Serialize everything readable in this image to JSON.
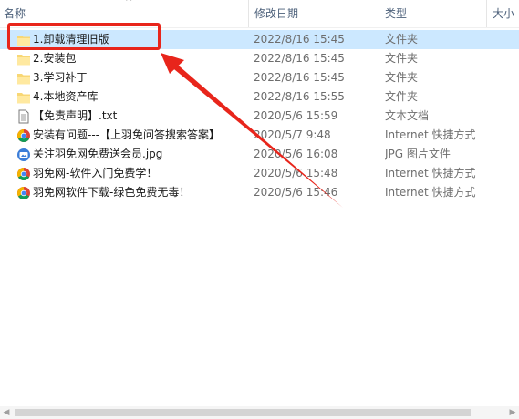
{
  "header": {
    "name_col": "名称",
    "date_col": "修改日期",
    "type_col": "类型",
    "size_col": "大小"
  },
  "files": [
    {
      "name": "1.卸载清理旧版",
      "date": "2022/8/16 15:45",
      "type": "文件夹",
      "icon": "folder-icon",
      "selected": true
    },
    {
      "name": "2.安装包",
      "date": "2022/8/16 15:45",
      "type": "文件夹",
      "icon": "folder-icon"
    },
    {
      "name": "3.学习补丁",
      "date": "2022/8/16 15:45",
      "type": "文件夹",
      "icon": "folder-icon"
    },
    {
      "name": "4.本地资产库",
      "date": "2022/8/16 15:55",
      "type": "文件夹",
      "icon": "folder-icon"
    },
    {
      "name": "【免责声明】.txt",
      "date": "2020/5/6 15:59",
      "type": "文本文档",
      "icon": "text-file-icon"
    },
    {
      "name": "安装有问题---【上羽免问答搜索答案】",
      "date": "2020/5/7 9:48",
      "type": "Internet 快捷方式",
      "icon": "internet-shortcut-icon"
    },
    {
      "name": "关注羽免网免费送会员.jpg",
      "date": "2020/5/6 16:08",
      "type": "JPG 图片文件",
      "icon": "image-file-icon"
    },
    {
      "name": "羽免网-软件入门免费学！",
      "date": "2020/5/6 15:48",
      "type": "Internet 快捷方式",
      "icon": "internet-shortcut-icon"
    },
    {
      "name": "羽免网软件下载-绿色免费无毒！",
      "date": "2020/5/6 15:46",
      "type": "Internet 快捷方式",
      "icon": "internet-shortcut-icon"
    }
  ],
  "colors": {
    "selection": "#cce8ff",
    "annotation": "#e8251b"
  }
}
